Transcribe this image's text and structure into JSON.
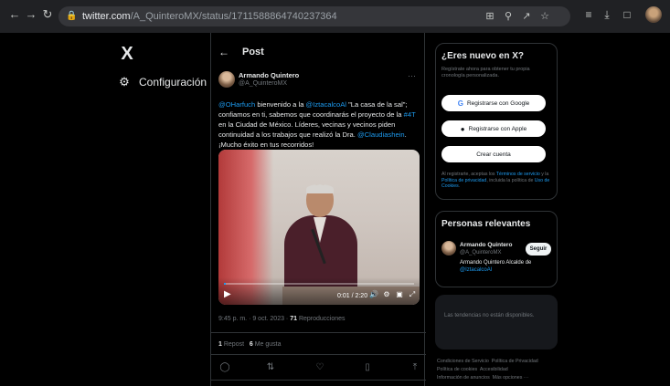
{
  "browser": {
    "url_host": "twitter.com",
    "url_path": "/A_QuinteroMX/status/1711588864740237364",
    "icons": {
      "back": "arrow-left-icon",
      "forward": "arrow-right-icon",
      "reload": "reload-icon",
      "lock": "lock-icon",
      "install": "install-app-icon",
      "zoom": "zoom-icon",
      "share": "share-icon",
      "bookmark": "star-icon",
      "queue": "reading-list-icon",
      "download": "download-icon",
      "window": "window-icon",
      "profile": "profile-avatar-icon"
    }
  },
  "left_nav": {
    "logo": "X",
    "items": [
      {
        "label": "Configuración",
        "icon": "gear-icon"
      }
    ]
  },
  "post_header": {
    "back_icon": "arrow-left-icon",
    "title": "Post"
  },
  "author": {
    "name": "Armando Quintero",
    "handle": "@A_QuinteroMX",
    "more": "···"
  },
  "tweet": {
    "parts": [
      {
        "text": "@OHarfuch",
        "link": true
      },
      {
        "text": " bienvenido a la ",
        "link": false
      },
      {
        "text": "@IztacalcoAl",
        "link": true
      },
      {
        "text": " \"La casa de la sal\"; confiamos en ti, sabemos que coordinarás el proyecto de la ",
        "link": false
      },
      {
        "text": "#4T",
        "link": true
      },
      {
        "text": " en la Ciudad de México. Líderes, vecinas y vecinos piden continuidad a los trabajos que realizó la Dra. ",
        "link": false
      },
      {
        "text": "@Claudiashein",
        "link": true
      },
      {
        "text": ". ¡Mucho éxito en tus recorridos!",
        "link": false
      }
    ]
  },
  "video": {
    "time": "0:01 / 2:20",
    "progress": 0.01,
    "icons": [
      "play-icon",
      "volume-icon",
      "settings-icon",
      "pip-icon",
      "fullscreen-icon"
    ]
  },
  "meta": {
    "datetime": "9:45 p. m. · 9 oct. 2023 · ",
    "views_count": "71",
    "views_label": " Reproducciones"
  },
  "stats": {
    "reposts_count": "1",
    "reposts_label": " Repost",
    "likes_count": "6",
    "likes_label": " Me gusta"
  },
  "actions": [
    "reply-icon",
    "repost-icon",
    "like-icon",
    "bookmark-icon",
    "share-icon"
  ],
  "signup": {
    "title": "¿Eres nuevo en X?",
    "subtitle": "Regístrate ahora para obtener tu propia cronología personalizada.",
    "google": "Registrarse con Google",
    "apple": "Registrarse con Apple",
    "create": "Crear cuenta",
    "legal_parts": [
      {
        "text": "Al registrarte, aceptas los ",
        "link": false
      },
      {
        "text": "Términos de servicio",
        "link": true
      },
      {
        "text": " y la ",
        "link": false
      },
      {
        "text": "Política de privacidad",
        "link": true
      },
      {
        "text": ", incluida la política de ",
        "link": false
      },
      {
        "text": "Uso de Cookies",
        "link": true
      },
      {
        "text": ".",
        "link": false
      }
    ]
  },
  "relevant": {
    "title": "Personas relevantes",
    "name": "Armando Quintero",
    "handle": "@A_QuinteroMX",
    "bio_text": "Armando Quintero Alcalde de ",
    "bio_link": "@IztacalcoAl",
    "follow": "Seguir"
  },
  "trends": {
    "text": "Las tendencias no están disponibles."
  },
  "footer": {
    "links": [
      "Condiciones de Servicio",
      "Política de Privacidad",
      "Política de cookies",
      "Accesibilidad",
      "Información de anuncios",
      "Más opciones ···"
    ]
  }
}
